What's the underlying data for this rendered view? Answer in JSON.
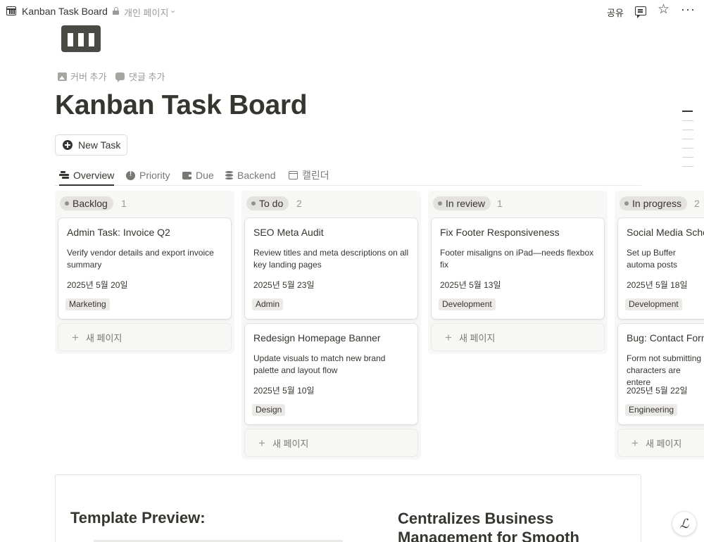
{
  "topbar": {
    "title": "Kanban Task Board",
    "privacy": "개인 페이지",
    "share": "공유"
  },
  "page": {
    "add_cover": "커버 추가",
    "add_comment": "댓글 추가",
    "title": "Kanban Task Board",
    "new_task": "New Task"
  },
  "tabs": [
    {
      "label": "Overview",
      "icon": "board-icon",
      "active": true
    },
    {
      "label": "Priority",
      "icon": "alert-icon"
    },
    {
      "label": "Due",
      "icon": "wallet-icon"
    },
    {
      "label": "Backend",
      "icon": "database-icon"
    },
    {
      "label": "캘린더",
      "icon": "calendar-icon"
    }
  ],
  "board": {
    "add_page_label": "새 페이지",
    "columns": [
      {
        "name": "Backlog",
        "count": "1",
        "pill_color": "#e3e2e0",
        "dot_color": "#91918e",
        "cards": [
          {
            "title": "Admin Task: Invoice Q2",
            "desc": "Verify vendor details and export invoice summary",
            "date": "2025년 5월 20일",
            "tag": "Marketing"
          }
        ]
      },
      {
        "name": "To do",
        "count": "2",
        "pill_color": "#e3e2e0",
        "dot_color": "#91918e",
        "cards": [
          {
            "title": "SEO Meta Audit",
            "desc": "Review titles and meta descriptions on all key landing pages",
            "date": "2025년 5월 23일",
            "tag": "Admin"
          },
          {
            "title": "Redesign Homepage Banner",
            "desc": "Update visuals to match new brand palette and layout flow",
            "date": "2025년 5월 10일",
            "tag": "Design"
          }
        ]
      },
      {
        "name": "In review",
        "count": "1",
        "pill_color": "#e3e2e0",
        "dot_color": "#91918e",
        "cards": [
          {
            "title": "Fix Footer Responsiveness",
            "desc": "Footer misaligns on iPad—needs flexbox fix",
            "date": "2025년 5월 13일",
            "tag": "Development"
          }
        ]
      },
      {
        "name": "In progress",
        "count": "2",
        "pill_color": "#e3e2e0",
        "dot_color": "#91918e",
        "cards": [
          {
            "title": "Social Media Sche",
            "desc": "Set up Buffer automa posts",
            "date": "2025년 5월 18일",
            "tag": "Development"
          },
          {
            "title": "Bug: Contact Forn",
            "desc": "Form not submitting characters are entere",
            "date": "2025년 5월 22일",
            "tag": "Engineering"
          }
        ]
      }
    ]
  },
  "preview": {
    "left_heading": "Template Preview:",
    "right_heading": "Centralizes Business Management for Smooth"
  },
  "help": "ℒ"
}
